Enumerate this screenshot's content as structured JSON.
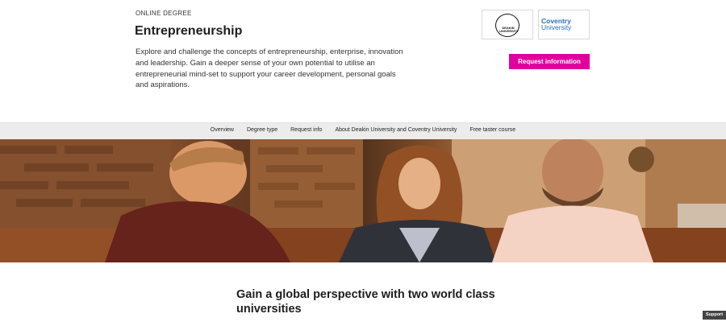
{
  "header": {
    "eyebrow": "ONLINE DEGREE",
    "title": "Entrepreneurship",
    "description": "Explore and challenge the concepts of entrepreneurship, enterprise, innovation and leadership. Gain a deeper sense of your own potential to utilise an entrepreneurial mind-set to support your career development, personal goals and aspirations.",
    "cta_label": "Request information",
    "cta_color": "#e2009d"
  },
  "logos": {
    "deakin": "DEAKIN UNIVERSITY",
    "coventry_line1": "Coventry",
    "coventry_line2": "University"
  },
  "subnav": {
    "items": [
      {
        "label": "Overview"
      },
      {
        "label": "Degree type"
      },
      {
        "label": "Request info"
      },
      {
        "label": "About Deakin University and Coventry University"
      },
      {
        "label": "Free taster course"
      }
    ]
  },
  "section": {
    "title": "Gain a global perspective with two world class universities"
  },
  "support": {
    "label": "Support"
  },
  "colors": {
    "accent": "#e2009d",
    "subnav_bg": "#ececec",
    "coventry_blue": "#2a6fc0"
  },
  "hero": {
    "icon": "hero-photo-image"
  }
}
